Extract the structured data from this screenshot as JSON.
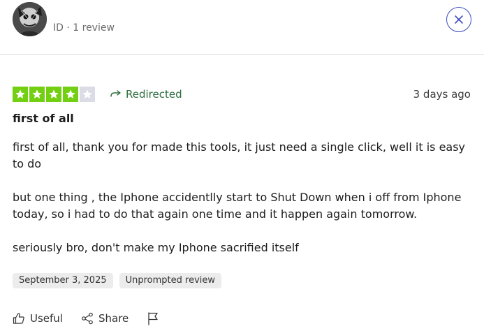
{
  "reviewer": {
    "meta": "ID · 1 review"
  },
  "review": {
    "rating": 4,
    "rating_max": 5,
    "star_color": "#73cf11",
    "star_empty_color": "#dcdce6",
    "redirected_label": "Redirected",
    "date_ago": "3 days ago",
    "title": "first of all",
    "body": [
      "first of all, thank you for made this tools, it just need a single click, well it is easy to do",
      "but one thing , the Iphone accidentlly start to Shut Down when i off from Iphone today, so i had to do that again one time and it happen again tomorrow.",
      "seriously bro, don't make my Iphone sacrified itself"
    ],
    "tags": [
      "September 3, 2025",
      "Unprompted review"
    ]
  },
  "actions": {
    "useful_label": "Useful",
    "share_label": "Share"
  },
  "colors": {
    "accent_blue": "#3b4cc0",
    "redirected_green": "#2b6d3d"
  }
}
